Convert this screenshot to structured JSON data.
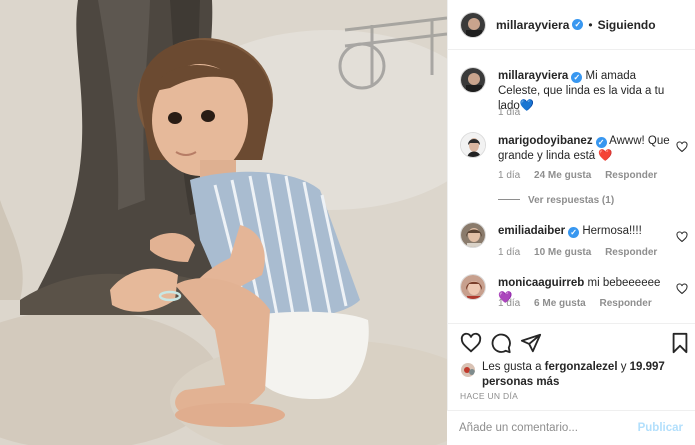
{
  "post": {
    "author": "millarayviera",
    "follow_state": "Siguiendo",
    "separator": "•"
  },
  "comments": [
    {
      "username": "millarayviera",
      "text": "Mi amada Celeste, que linda es la vida a tu lado💙",
      "time": "1 día",
      "likes": "",
      "reply": ""
    },
    {
      "username": "marigodoyibanez",
      "text": "Awww! Que grande y linda está ❤️",
      "time": "1 día",
      "likes": "24 Me gusta",
      "reply": "Responder",
      "view_replies": "Ver respuestas (1)"
    },
    {
      "username": "emiliadaiber",
      "text": "Hermosa!!!!",
      "time": "1 día",
      "likes": "10 Me gusta",
      "reply": "Responder"
    },
    {
      "username": "monicaaguirreb",
      "text": "mi bebeeeeee💜",
      "time": "1 día",
      "likes": "6 Me gusta",
      "reply": "Responder"
    }
  ],
  "likes_summary": {
    "prefix": "Les gusta a ",
    "user": "fergonzalezel",
    "middle": " y ",
    "count": "19.997 personas más"
  },
  "time_ago": "HACE UN DÍA",
  "comment_box": {
    "placeholder": "Añade un comentario...",
    "publish": "Publicar"
  },
  "icons": {
    "like": "heart-icon",
    "comment": "comment-icon",
    "share": "share-icon",
    "save": "bookmark-icon",
    "verified": "verified-badge-icon"
  },
  "colors": {
    "verified": "#3897f0",
    "muted": "#8e8e8e",
    "publish_disabled": "#b2dffc",
    "heart_emoji": "#ed4956",
    "purple_heart": "#a95fd8",
    "blue_heart": "#3b8ff0"
  }
}
